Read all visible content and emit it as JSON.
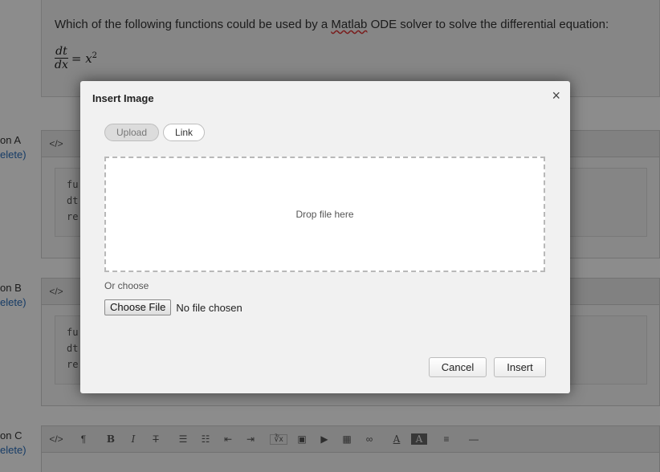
{
  "question": {
    "text_before": "Which of the following functions could be used by a ",
    "text_underlined": "Matlab",
    "text_after": " ODE solver to solve the differential equation:",
    "formula_num": "dt",
    "formula_den": "dx",
    "formula_rest": "= x",
    "formula_exp": "2"
  },
  "options": [
    {
      "label": "on A",
      "delete": "elete)"
    },
    {
      "label": "on B",
      "delete": "elete)"
    },
    {
      "label": "on C",
      "delete": "elete)"
    }
  ],
  "code_lines": [
    "fu",
    "dt",
    "re"
  ],
  "toolbar": {
    "source": "</>",
    "paragraph": "¶",
    "bold": "B",
    "italic": "I",
    "strike": "T",
    "bullets": "☰",
    "numbers": "☷",
    "outdent": "⇤",
    "indent": "⇥",
    "math": "∛x",
    "image": "▣",
    "video": "▶",
    "table": "▦",
    "link": "∞",
    "font_color": "A",
    "bg_color": "A",
    "align": "≡",
    "hr": "—"
  },
  "modal": {
    "title": "Insert Image",
    "close": "×",
    "tabs": [
      "Upload",
      "Link"
    ],
    "drop_text": "Drop file here",
    "or_choose": "Or choose",
    "choose_file": "Choose File",
    "file_status": "No file chosen",
    "cancel": "Cancel",
    "insert": "Insert"
  }
}
